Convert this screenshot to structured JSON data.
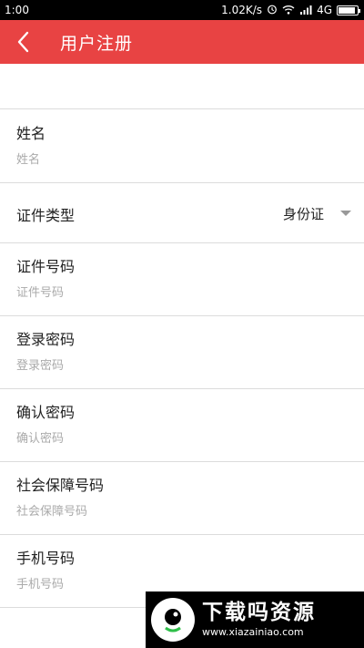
{
  "status_bar": {
    "time": "1:00",
    "net_speed": "1.02K/s",
    "network": "4G",
    "battery_level": 0.9
  },
  "app_bar": {
    "title": "用户注册",
    "back_icon": "chevron-left-icon"
  },
  "form": {
    "name": {
      "label": "姓名",
      "placeholder": "姓名",
      "value": ""
    },
    "id_type": {
      "label": "证件类型",
      "value": "身份证"
    },
    "id_number": {
      "label": "证件号码",
      "placeholder": "证件号码",
      "value": ""
    },
    "login_password": {
      "label": "登录密码",
      "placeholder": "登录密码",
      "value": ""
    },
    "confirm_password": {
      "label": "确认密码",
      "placeholder": "确认密码",
      "value": ""
    },
    "social_security": {
      "label": "社会保障号码",
      "placeholder": "社会保障号码",
      "value": ""
    },
    "phone": {
      "label": "手机号码",
      "placeholder": "手机号码",
      "value": ""
    }
  },
  "watermark": {
    "title": "下载吗资源",
    "url": "www.xiazainiao.com"
  },
  "colors": {
    "app_bar": "#e84343",
    "divider": "#dcdcdc",
    "placeholder": "#aaaaaa"
  }
}
